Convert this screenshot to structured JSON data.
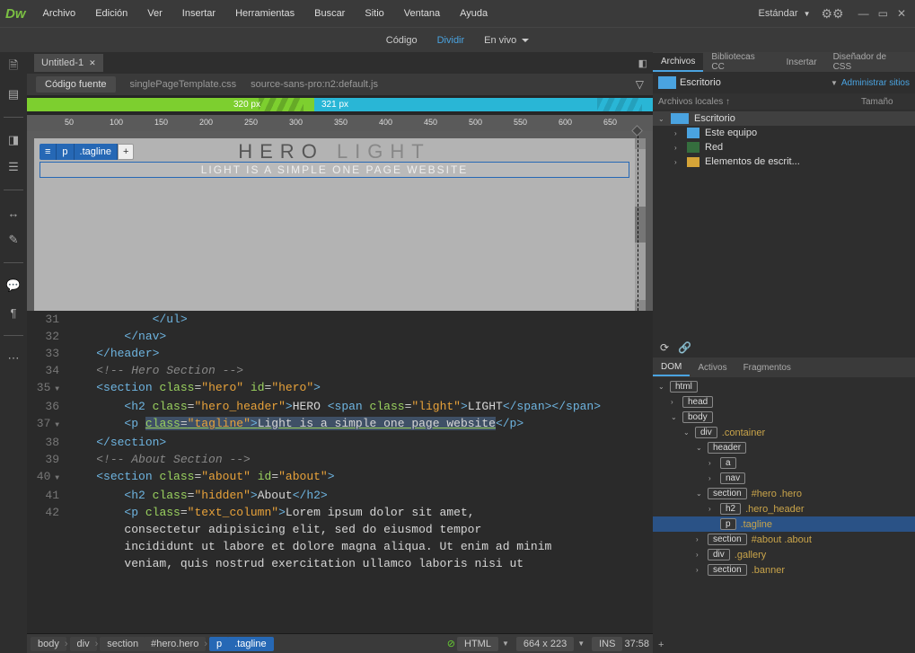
{
  "workspace": "Estándar",
  "menu": [
    "Archivo",
    "Edición",
    "Ver",
    "Insertar",
    "Herramientas",
    "Buscar",
    "Sitio",
    "Ventana",
    "Ayuda"
  ],
  "switcher": {
    "code": "Código",
    "split": "Dividir",
    "live": "En vivo"
  },
  "tab": {
    "name": "Untitled-1"
  },
  "related": {
    "source": "Código fuente",
    "css": "singlePageTemplate.css",
    "js": "source-sans-pro:n2:default.js"
  },
  "breakpoints": {
    "green": "320  px",
    "blue": "321  px"
  },
  "ruler": [
    "50",
    "100",
    "150",
    "200",
    "250",
    "300",
    "350",
    "400",
    "450",
    "500",
    "550",
    "600",
    "650"
  ],
  "preview": {
    "crumbs": [
      "≡",
      "p",
      ".tagline",
      "+"
    ],
    "heroA": "HERO",
    "heroB": "LIGHT",
    "tagline": "LIGHT IS A SIMPLE ONE PAGE WEBSITE"
  },
  "code": {
    "lines": [
      {
        "n": 31,
        "v": false,
        "html": "            <span class='cl-tag'>&lt;/ul&gt;</span>"
      },
      {
        "n": 32,
        "v": false,
        "html": "        <span class='cl-tag'>&lt;/nav&gt;</span>"
      },
      {
        "n": 33,
        "v": false,
        "html": "    <span class='cl-tag'>&lt;/header&gt;</span>"
      },
      {
        "n": 34,
        "v": false,
        "html": "    <span class='cl-com'>&lt;!-- Hero Section --&gt;</span>"
      },
      {
        "n": 35,
        "v": true,
        "html": "    <span class='cl-tag'>&lt;section</span> <span class='cl-attr'>class</span>=<span class='cl-str'>\"hero\"</span> <span class='cl-attr'>id</span>=<span class='cl-str'>\"hero\"</span><span class='cl-tag'>&gt;</span>"
      },
      {
        "n": 36,
        "v": false,
        "html": "        <span class='cl-tag'>&lt;h2</span> <span class='cl-attr'>class</span>=<span class='cl-str'>\"hero_header\"</span><span class='cl-tag'>&gt;</span><span class='cl-txt'>HERO </span><span class='cl-tag'>&lt;span</span> <span class='cl-attr'>class</span>=<span class='cl-str'>\"light\"</span><span class='cl-tag'>&gt;</span><span class='cl-txt'>LIGHT</span><span class='cl-tag'>&lt;/span&gt;</span><span class='cl-tag'>&lt;/span&gt;</span>"
      },
      {
        "n": 37,
        "v": true,
        "html": "        <span class='cl-tag'>&lt;p</span> <span class='hl-bg underline'><span class='cl-attr'>class</span>=<span class='cl-str'>\"tagline\"</span><span class='cl-tag'>&gt;</span><span class='cl-txt'>Light is a simple one page website</span></span><span class='cl-tag'>&lt;/p&gt;</span>"
      },
      {
        "n": 38,
        "v": false,
        "html": "    <span class='cl-tag'>&lt;/section&gt;</span>"
      },
      {
        "n": 39,
        "v": false,
        "html": "    <span class='cl-com'>&lt;!-- About Section --&gt;</span>"
      },
      {
        "n": 40,
        "v": true,
        "html": "    <span class='cl-tag'>&lt;section</span> <span class='cl-attr'>class</span>=<span class='cl-str'>\"about\"</span> <span class='cl-attr'>id</span>=<span class='cl-str'>\"about\"</span><span class='cl-tag'>&gt;</span>"
      },
      {
        "n": 41,
        "v": false,
        "html": "        <span class='cl-tag'>&lt;h2</span> <span class='cl-attr'>class</span>=<span class='cl-str'>\"hidden\"</span><span class='cl-tag'>&gt;</span><span class='cl-txt'>About</span><span class='cl-tag'>&lt;/h2&gt;</span>"
      },
      {
        "n": 42,
        "v": false,
        "html": "        <span class='cl-tag'>&lt;p</span> <span class='cl-attr'>class</span>=<span class='cl-str'>\"text_column\"</span><span class='cl-tag'>&gt;</span><span class='cl-txt'>Lorem ipsum dolor sit amet,</span>"
      },
      {
        "n": "",
        "v": false,
        "html": "        <span class='cl-txt'>consectetur adipisicing elit, sed do eiusmod tempor</span>"
      },
      {
        "n": "",
        "v": false,
        "html": "        <span class='cl-txt'>incididunt ut labore et dolore magna aliqua. Ut enim ad minim</span>"
      },
      {
        "n": "",
        "v": false,
        "html": "        <span class='cl-txt'>veniam, quis nostrud exercitation ullamco laboris nisi ut</span>"
      }
    ]
  },
  "status": {
    "crumbs": [
      "body",
      "div",
      "section",
      "#hero.hero",
      "p",
      ".tagline"
    ],
    "lang": "HTML",
    "dims": "664 x 223",
    "ins": "INS",
    "time": "37:58"
  },
  "rightTabs": [
    "Archivos",
    "Bibliotecas CC",
    "Insertar",
    "Diseñador de CSS"
  ],
  "files": {
    "root": "Escritorio",
    "manage": "Administrar sitios",
    "hdr": [
      "Archivos locales ↑",
      "Tamaño"
    ],
    "tree": [
      {
        "ind": 0,
        "open": true,
        "icn": "ic-desk",
        "label": "Escritorio"
      },
      {
        "ind": 1,
        "open": false,
        "icn": "ic-pc",
        "label": "Este equipo"
      },
      {
        "ind": 1,
        "open": false,
        "icn": "ic-net",
        "label": "Red"
      },
      {
        "ind": 1,
        "open": false,
        "icn": "ic-fold",
        "label": "Elementos de escrit..."
      }
    ]
  },
  "domTabs": [
    "DOM",
    "Activos",
    "Fragmentos"
  ],
  "dom": [
    {
      "ind": 0,
      "open": true,
      "tag": "html",
      "meta": ""
    },
    {
      "ind": 1,
      "open": false,
      "tag": "head",
      "meta": ""
    },
    {
      "ind": 1,
      "open": true,
      "tag": "body",
      "meta": ""
    },
    {
      "ind": 2,
      "open": true,
      "tag": "div",
      "meta": ".container"
    },
    {
      "ind": 3,
      "open": true,
      "tag": "header",
      "meta": ""
    },
    {
      "ind": 4,
      "open": false,
      "tag": "a",
      "meta": ""
    },
    {
      "ind": 4,
      "open": false,
      "tag": "nav",
      "meta": ""
    },
    {
      "ind": 3,
      "open": true,
      "tag": "section",
      "meta": "#hero .hero",
      "sec": false
    },
    {
      "ind": 4,
      "open": false,
      "tag": "h2",
      "meta": ".hero_header"
    },
    {
      "ind": 4,
      "open": null,
      "tag": "p",
      "meta": ".tagline",
      "sel": true
    },
    {
      "ind": 3,
      "open": false,
      "tag": "section",
      "meta": "#about .about"
    },
    {
      "ind": 3,
      "open": false,
      "tag": "div",
      "meta": ".gallery"
    },
    {
      "ind": 3,
      "open": false,
      "tag": "section",
      "meta": ".banner"
    }
  ]
}
